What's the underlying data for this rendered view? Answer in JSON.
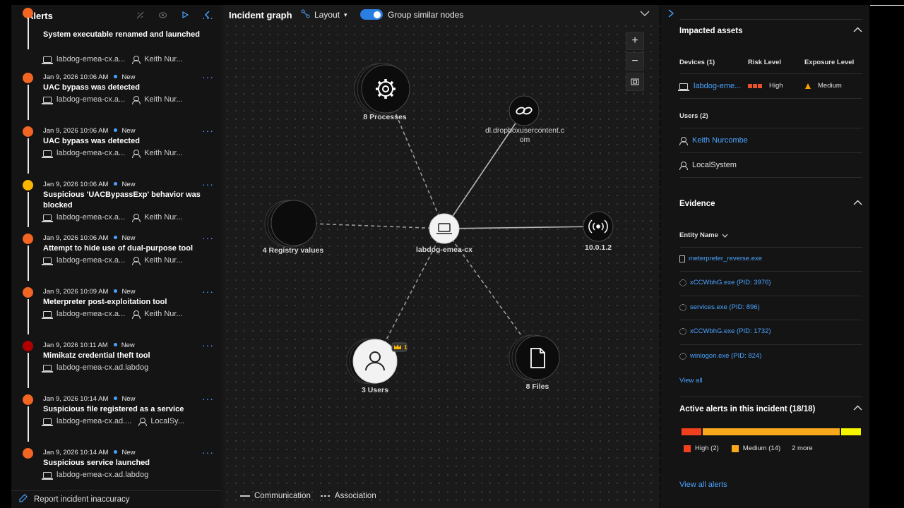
{
  "left_panel": {
    "title": "Alerts",
    "footer_label": "Report incident inaccuracy",
    "alerts": [
      {
        "meta": "",
        "status": "",
        "title": "System executable renamed and launched",
        "device": "labdog-emea-cx.a...",
        "user": "Keith Nur...",
        "severity_color": "#f26522"
      },
      {
        "meta": "Jan 9, 2026 10:06 AM",
        "status": "New",
        "title": "UAC bypass was detected",
        "device": "labdog-emea-cx.a...",
        "user": "Keith Nur...",
        "severity_color": "#f26522"
      },
      {
        "meta": "Jan 9, 2026 10:06 AM",
        "status": "New",
        "title": "UAC bypass was detected",
        "device": "labdog-emea-cx.a...",
        "user": "Keith Nur...",
        "severity_color": "#f26522"
      },
      {
        "meta": "Jan 9, 2026 10:06 AM",
        "status": "New",
        "title": "Suspicious 'UACBypassExp' behavior was blocked",
        "device": "labdog-emea-cx.a...",
        "user": "Keith Nur...",
        "severity_color": "#f7b500"
      },
      {
        "meta": "Jan 9, 2026 10:06 AM",
        "status": "New",
        "title": "Attempt to hide use of dual-purpose tool",
        "device": "labdog-emea-cx.a...",
        "user": "Keith Nur...",
        "severity_color": "#f26522"
      },
      {
        "meta": "Jan 9, 2026 10:09 AM",
        "status": "New",
        "title": "Meterpreter post-exploitation tool",
        "device": "labdog-emea-cx.a...",
        "user": "Keith Nur...",
        "severity_color": "#f26522"
      },
      {
        "meta": "Jan 9, 2026 10:11 AM",
        "status": "New",
        "title": "Mimikatz credential theft tool",
        "device": "labdog-emea-cx.ad.labdog",
        "user": "",
        "severity_color": "#b00000"
      },
      {
        "meta": "Jan 9, 2026 10:14 AM",
        "status": "New",
        "title": "Suspicious file registered as a service",
        "device": "labdog-emea-cx.ad....",
        "user": "LocalSy...",
        "severity_color": "#f26522"
      },
      {
        "meta": "Jan 9, 2026 10:14 AM",
        "status": "New",
        "title": "Suspicious service launched",
        "device": "labdog-emea-cx.ad.labdog",
        "user": "",
        "severity_color": "#f26522"
      }
    ]
  },
  "graph": {
    "title": "Incident graph",
    "layout_label": "Layout",
    "group_label": "Group similar nodes",
    "group_enabled": true,
    "legend_communication": "Communication",
    "legend_association": "Association",
    "nodes": {
      "center": "labdog-emea-cx",
      "processes": "8 Processes",
      "url": "dl.dropboxusercontent.c",
      "url2": "om",
      "registry": "4 Registry values",
      "ip": "10.0.1.2",
      "users": "3 Users",
      "files": "8 Files",
      "users_badge": "1"
    }
  },
  "right_panel": {
    "impacted_title": "Impacted assets",
    "devices_header": "Devices (1)",
    "risk_header": "Risk Level",
    "exposure_header": "Exposure Level",
    "device_name": "labdog-eme...",
    "risk_value": "High",
    "exposure_value": "Medium",
    "users_header": "Users (2)",
    "user1": "Keith Nurcombe",
    "user2": "LocalSystem",
    "evidence_title": "Evidence",
    "entity_name_header": "Entity Name",
    "evidence": [
      "meterpreter_reverse.exe",
      "xCCWbhG.exe (PID: 3976)",
      "services.exe (PID: 896)",
      "xCCWbhG.exe (PID: 1732)",
      "winlogon.exe (PID: 824)"
    ],
    "view_all": "View all",
    "active_alerts_title": "Active alerts in this incident (18/18)",
    "sev_high": "High (2)",
    "sev_medium": "Medium (14)",
    "sev_more": "2 more",
    "view_all_alerts": "View all alerts",
    "sev_colors": {
      "high": "#f0401e",
      "medium": "#f7a91b",
      "low": "#f5f500"
    }
  }
}
